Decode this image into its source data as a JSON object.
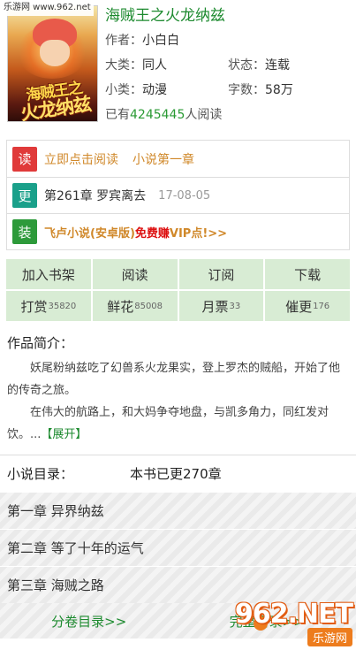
{
  "watermark_top": "乐游网 www.962.net",
  "book": {
    "cover_alt": "海贼王之火龙纳兹 cover",
    "cover_text_line1": "海贼王之",
    "cover_text_line2": "火龙纳兹",
    "title": "海贼王之火龙纳兹",
    "author_label": "作者：",
    "author": "小白白",
    "category_label": "大类：",
    "category": "同人",
    "status_label": "状态：",
    "status": "连载",
    "subcategory_label": "小类：",
    "subcategory": "动漫",
    "wordcount_label": "字数：",
    "wordcount": "58万",
    "readers_prefix": "已有",
    "readers": "4245445",
    "readers_suffix": "人阅读"
  },
  "actions": {
    "read": {
      "badge": "读",
      "text": "立即点击阅读",
      "text2": "小说第一章"
    },
    "update": {
      "badge": "更",
      "chapter": "第261章 罗宾离去",
      "date": "17-08-05"
    },
    "install": {
      "badge": "装",
      "promo_a": "飞卢小说(安卓版)",
      "promo_em": "免费赚",
      "promo_b": "VIP点!>>"
    }
  },
  "buttons": [
    {
      "label": "加入书架",
      "count": ""
    },
    {
      "label": "阅读",
      "count": ""
    },
    {
      "label": "订阅",
      "count": ""
    },
    {
      "label": "下载",
      "count": ""
    },
    {
      "label": "打赏",
      "count": "35820"
    },
    {
      "label": "鲜花",
      "count": "85008"
    },
    {
      "label": "月票",
      "count": "33"
    },
    {
      "label": "催更",
      "count": "176"
    }
  ],
  "intro": {
    "heading": "作品简介：",
    "p1": "妖尾粉纳兹吃了幻兽系火龙果实，登上罗杰的贼船，开始了他的传奇之旅。",
    "p2": "在伟大的航路上，和大妈争夺地盘，与凯多角力，同红发对饮。...",
    "expand": "【展开】"
  },
  "catalog": {
    "label": "小说目录：",
    "updated": "本书已更270章",
    "chapters": [
      "第一章 异界纳兹",
      "第二章 等了十年的运气",
      "第三章 海贼之路"
    ],
    "link_volumes": "分卷目录>>",
    "link_full": "完整目录>>"
  },
  "watermark_br": {
    "logo": "962.NET",
    "sub": "乐游网"
  },
  "colors": {
    "green": "#1d8a2f",
    "orange": "#d0882a",
    "red_badge": "#e03a3a",
    "teal_badge": "#1aa08a",
    "green_badge": "#2d9a3a",
    "button_bg": "#d8ecd4"
  }
}
